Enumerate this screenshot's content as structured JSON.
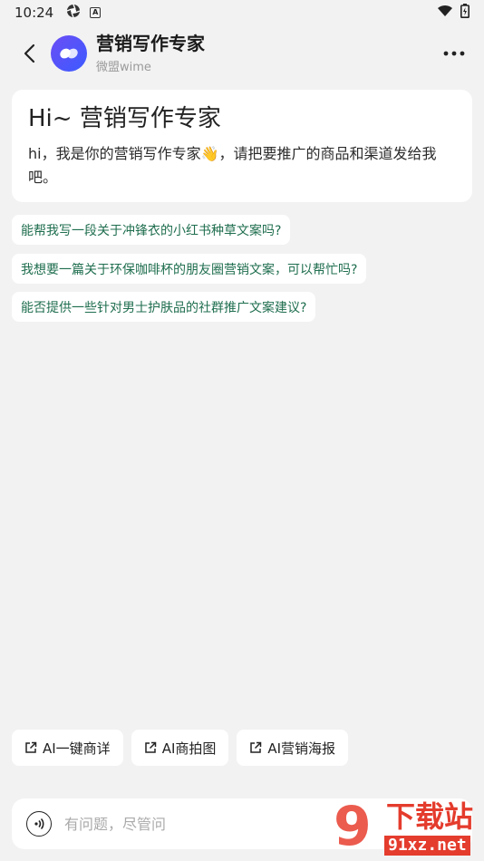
{
  "status_bar": {
    "time": "10:24",
    "left_icons": [
      "aperture-icon",
      "a-box-icon"
    ],
    "right_icons": [
      "wifi-icon",
      "battery-icon"
    ]
  },
  "header": {
    "back_icon": "chevron-left-icon",
    "title": "营销写作专家",
    "subtitle": "微盟wime",
    "more_icon": "more-dots-icon"
  },
  "greeting": {
    "title": "Hi~ 营销写作专家",
    "text": "hi，我是你的营销写作专家👋，请把要推广的商品和渠道发给我吧。"
  },
  "suggestions": [
    "能帮我写一段关于冲锋衣的小红书种草文案吗?",
    "我想要一篇关于环保咖啡杯的朋友圈营销文案，可以帮忙吗?",
    "能否提供一些针对男士护肤品的社群推广文案建议?"
  ],
  "quick_actions": [
    {
      "label": "AI一键商详",
      "icon": "external-link-icon"
    },
    {
      "label": "AI商拍图",
      "icon": "external-link-icon"
    },
    {
      "label": "AI营销海报",
      "icon": "external-link-icon"
    }
  ],
  "input": {
    "placeholder": "有问题，尽管问",
    "value": "",
    "voice_icon": "voice-icon"
  },
  "watermark": {
    "brand_char": "9",
    "text": "下载站",
    "url": "91xz.net"
  },
  "colors": {
    "background": "#f2f2f3",
    "suggestion_text": "#1f6e4f",
    "avatar_gradient_start": "#6b4df5",
    "avatar_gradient_end": "#3b5bff",
    "watermark_red": "#e43c2d"
  }
}
